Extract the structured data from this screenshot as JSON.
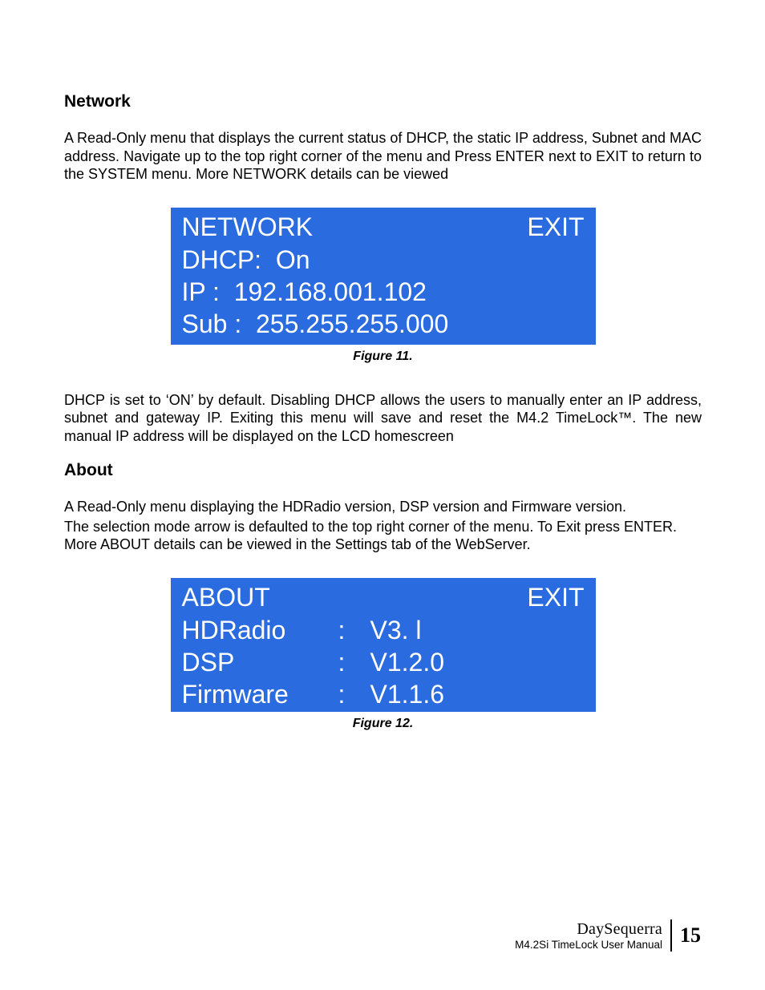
{
  "section1": {
    "heading": "Network",
    "para1": "A Read-Only menu that displays the current status of DHCP, the static IP address, Subnet and MAC address.  Navigate up to the top right corner of the menu and Press ENTER next to EXIT to return to the SYSTEM menu.  More NETWORK details can be viewed",
    "lcd": {
      "title": "NETWORK",
      "exit": "EXIT",
      "dhcp": "DHCP:  On",
      "ip": "IP :  192.168.001.102",
      "sub": "Sub :  255.255.255.000"
    },
    "caption": "Figure 11.",
    "para2": "DHCP is set to ‘ON’ by default.  Disabling DHCP allows the users to manually enter an IP address, subnet and gateway IP.  Exiting this menu will save and reset the M4.2 TimeLock™.  The new manual IP address will be displayed on the LCD homescreen"
  },
  "section2": {
    "heading": "About",
    "para1": "A Read-Only menu displaying the HDRadio version, DSP version and Firmware version.",
    "para2": "The selection mode arrow is defaulted to the top right corner of the menu.  To Exit press ENTER.  More ABOUT details can be viewed in the Settings tab of the WebServer.",
    "lcd": {
      "title": "ABOUT",
      "exit": "EXIT",
      "rows": [
        {
          "label": "HDRadio",
          "colon": ":",
          "value": "V3. l"
        },
        {
          "label": "DSP",
          "colon": ":",
          "value": "V1.2.0"
        },
        {
          "label": "Firmware",
          "colon": ":",
          "value": "V1.1.6"
        }
      ]
    },
    "caption": "Figure 12."
  },
  "footer": {
    "brand": "DaySequerra",
    "manual": "M4.2Si TimeLock User Manual",
    "page": "15"
  }
}
